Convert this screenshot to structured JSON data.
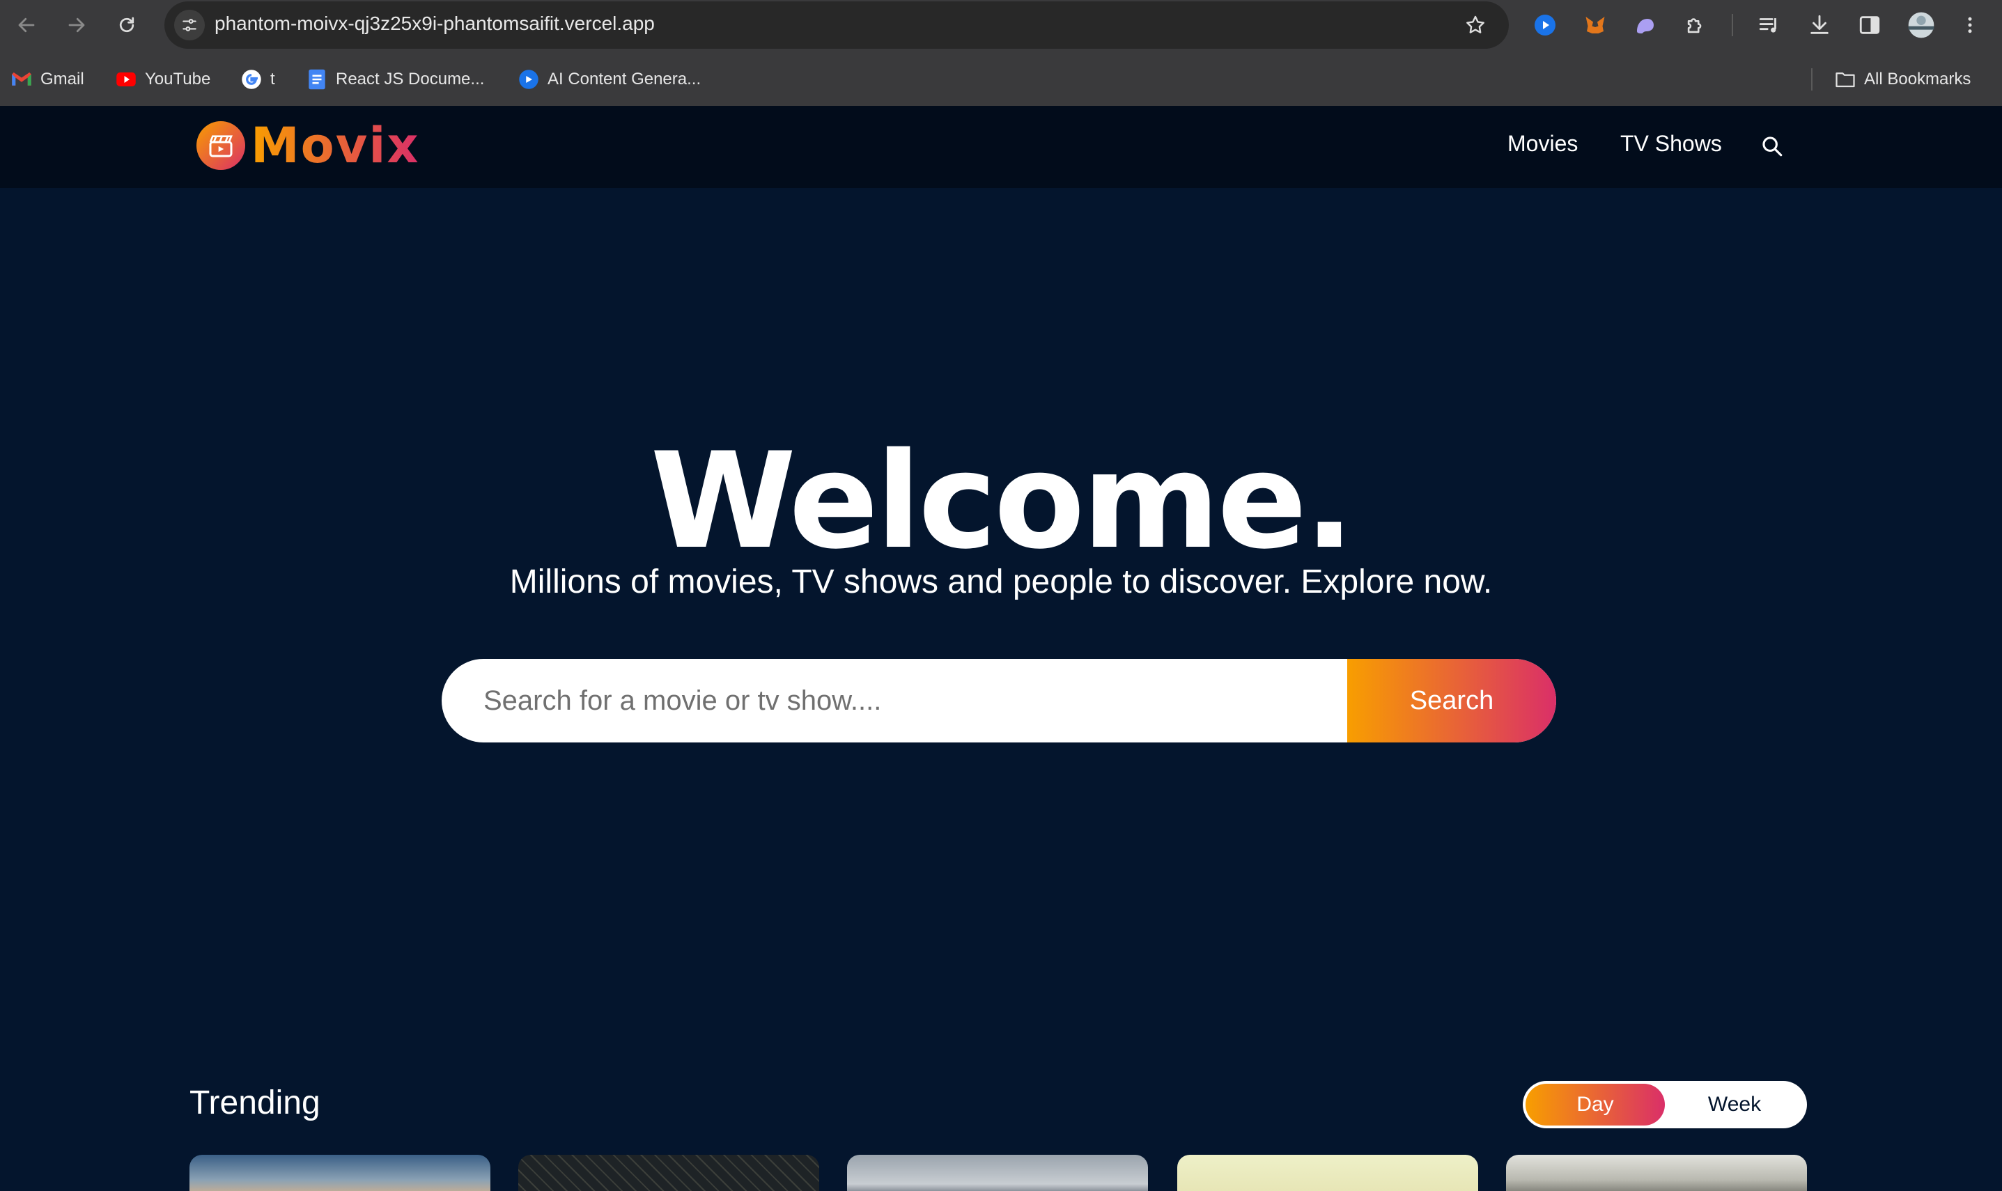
{
  "browser": {
    "url": "phantom-moivx-qj3z25x9i-phantomsaifit.vercel.app",
    "bookmarks": [
      {
        "label": "Gmail",
        "icon": "gmail-icon"
      },
      {
        "label": "YouTube",
        "icon": "youtube-icon"
      },
      {
        "label": "t",
        "icon": "google-icon"
      },
      {
        "label": "React JS Docume...",
        "icon": "docs-icon"
      },
      {
        "label": "AI Content Genera...",
        "icon": "ai-content-icon"
      }
    ],
    "all_bookmarks_label": "All Bookmarks"
  },
  "site": {
    "logo_text": "Movix",
    "nav": {
      "movies": "Movies",
      "tv_shows": "TV Shows"
    }
  },
  "hero": {
    "title": "Welcome.",
    "subtitle": "Millions of movies, TV shows and people to discover. Explore now.",
    "search_placeholder": "Search for a movie or tv show....",
    "search_button": "Search"
  },
  "trending": {
    "title": "Trending",
    "tabs": [
      "Day",
      "Week"
    ],
    "active_tab": "Day"
  },
  "colors": {
    "background": "#04152d",
    "header": "#020c1b",
    "gradient_start": "#f89e00",
    "gradient_end": "#da2f68"
  }
}
